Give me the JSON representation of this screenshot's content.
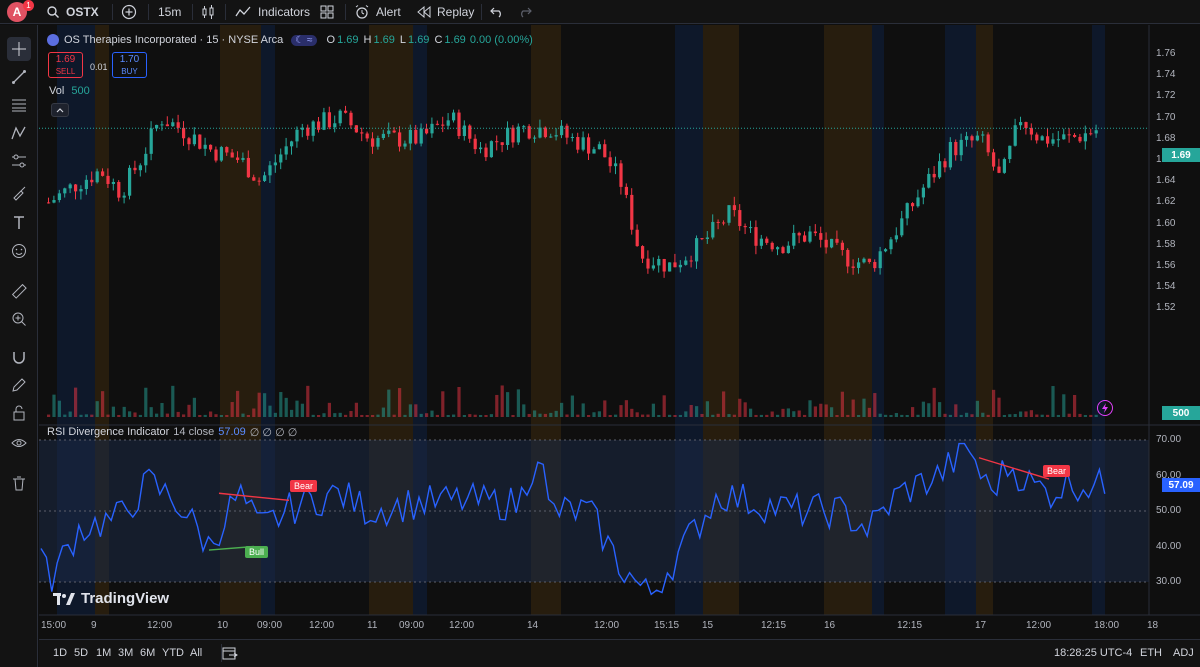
{
  "topbar": {
    "avatar_letter": "A",
    "notification_count": "1",
    "symbol": "OSTX",
    "interval": "15m",
    "indicators_label": "Indicators",
    "alert_label": "Alert",
    "replay_label": "Replay"
  },
  "legend": {
    "title": "OS Therapies Incorporated · 15 · NYSE Arca",
    "o_label": "O",
    "o_value": "1.69",
    "h_label": "H",
    "h_value": "1.69",
    "l_label": "L",
    "l_value": "1.69",
    "c_label": "C",
    "c_value": "1.69",
    "change": "0.00 (0.00%)",
    "sell_price": "1.69",
    "sell_label": "SELL",
    "spread": "0.01",
    "buy_price": "1.70",
    "buy_label": "BUY",
    "vol_label": "Vol",
    "vol_value": "500"
  },
  "price_axis": {
    "labels": [
      "1.76",
      "1.74",
      "1.72",
      "1.70",
      "1.68",
      "1.66",
      "1.64",
      "1.62",
      "1.60",
      "1.58",
      "1.56",
      "1.54",
      "1.52"
    ],
    "current_price": "1.69",
    "volume_tag": "500"
  },
  "rsi": {
    "title": "RSI Divergence Indicator",
    "params": "14 close",
    "value": "57.09",
    "extras": "∅ ∅ ∅ ∅",
    "axis_labels": [
      "70.00",
      "60.00",
      "50.00",
      "40.00",
      "30.00"
    ],
    "current_tag": "57.09",
    "bear_label": "Bear",
    "bull_label": "Bull"
  },
  "time_axis": {
    "labels": [
      "15:00",
      "9",
      "12:00",
      "10",
      "09:00",
      "12:00",
      "11",
      "09:00",
      "12:00",
      "14",
      "12:00",
      "15:15",
      "15",
      "12:15",
      "16",
      "12:15",
      "17",
      "12:00",
      "18:00",
      "18"
    ]
  },
  "watermark": "TradingView",
  "bottombar": {
    "ranges": [
      "1D",
      "5D",
      "1M",
      "3M",
      "6M",
      "YTD",
      "All"
    ],
    "clock": "18:28:25 UTC-4",
    "session": "ETH",
    "adj": "ADJ"
  },
  "colors": {
    "up": "#26a69a",
    "down": "#f23645",
    "rsi_line": "#2962ff",
    "bear": "#f23645",
    "bull": "#4caf50",
    "session_orange": "#2a1f0e",
    "session_blue": "#0e1a2e"
  }
}
